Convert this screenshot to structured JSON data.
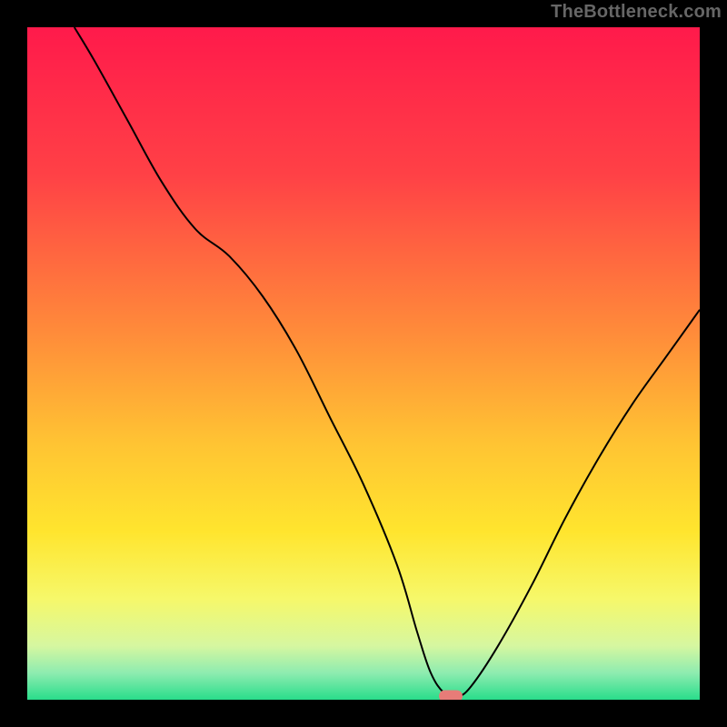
{
  "attribution": "TheBottleneck.com",
  "chart_data": {
    "type": "line",
    "title": "",
    "xlabel": "",
    "ylabel": "",
    "xlim": [
      0,
      100
    ],
    "ylim": [
      0,
      100
    ],
    "grid": false,
    "legend": false,
    "series": [
      {
        "name": "bottleneck-curve",
        "x": [
          7,
          10,
          15,
          20,
          25,
          30,
          35,
          40,
          45,
          50,
          55,
          58,
          60,
          62,
          64,
          66,
          70,
          75,
          80,
          85,
          90,
          95,
          100
        ],
        "y": [
          100,
          95,
          86,
          77,
          70,
          66,
          60,
          52,
          42,
          32,
          20,
          10,
          4,
          1,
          0.5,
          2,
          8,
          17,
          27,
          36,
          44,
          51,
          58
        ]
      }
    ],
    "marker": {
      "x": 63,
      "y": 0
    },
    "gradient_stops": [
      {
        "offset": 0,
        "color": "#ff1a4b"
      },
      {
        "offset": 22,
        "color": "#ff4146"
      },
      {
        "offset": 45,
        "color": "#ff8a3a"
      },
      {
        "offset": 62,
        "color": "#ffc433"
      },
      {
        "offset": 75,
        "color": "#ffe52e"
      },
      {
        "offset": 85,
        "color": "#f6f86a"
      },
      {
        "offset": 92,
        "color": "#d6f7a0"
      },
      {
        "offset": 96,
        "color": "#8eecb0"
      },
      {
        "offset": 100,
        "color": "#29dd8b"
      }
    ],
    "curve_color": "#000000",
    "curve_width": 2
  }
}
